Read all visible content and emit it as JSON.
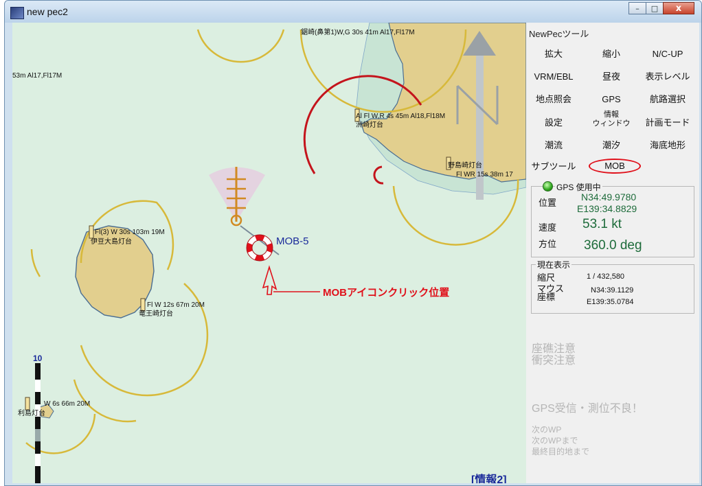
{
  "window": {
    "title": "new pec2",
    "min_label": "–",
    "max_label": "□",
    "close_label": "x"
  },
  "map": {
    "labels": [
      "鋸崎(鼻第1)W,G 30s 41m Al17,Fl17M",
      "53m Al17,Fl17M",
      "Al Fl W,R 4s 45m Al18,Fl18M",
      "洲崎灯台",
      "野島崎灯台",
      "Fl WR 15s 38m 17",
      "Fl(3) W 30s 103m 19M",
      "伊豆大島灯台",
      "Fl W 12s 67m 20M",
      "竜王崎灯台",
      "W 6s 66m 20M",
      "利島灯台"
    ],
    "scale_mark": "10",
    "mob_label": "MOB-5",
    "annotation": "MOBアイコンクリック位置",
    "info_tab": "[情報2]"
  },
  "panel": {
    "title": "NewPecツール",
    "buttons": {
      "zoom_in": "拡大",
      "zoom_out": "縮小",
      "nc_up": "N/C-UP",
      "vrm_ebl": "VRM/EBL",
      "day_night": "昼夜",
      "display_level": "表示レベル",
      "point_lookup": "地点照会",
      "gps": "GPS",
      "route_select": "航路選択",
      "settings": "設定",
      "info_window_1": "情報",
      "info_window_2": "ウィンドウ",
      "plan_mode": "計画モード",
      "current": "潮流",
      "tide": "潮汐",
      "seabed": "海底地形",
      "subtool": "サブツール",
      "mob": "MOB"
    },
    "gps": {
      "legend": "GPS 使用中",
      "position_label": "位置",
      "lat": "N34:49.9780",
      "lon": "E139:34.8829",
      "speed_label": "速度",
      "speed": "53.1  kt",
      "heading_label": "方位",
      "heading": "360.0  deg",
      "status_color": "#2ea61d"
    },
    "current_display": {
      "legend": "現在表示",
      "scale_label": "縮尺",
      "scale": "1 / 432,580",
      "mouse_label_1": "マウス",
      "mouse_label_2": "座標",
      "mouse_lat": "N34:39.1129",
      "mouse_lon": "E139:35.0784"
    },
    "warnings": {
      "grounding": "座礁注意",
      "collision": "衝突注意",
      "gps_error": "GPS受信・測位不良！",
      "next_wp": "次のWP",
      "to_next_wp": "次のWPまで",
      "to_final": "最終目的地まで"
    }
  },
  "colors": {
    "sea": "#dcefe1",
    "land": "#e2cf8e",
    "light_arc": "#d7b93a",
    "mob_red": "#e0101a",
    "label_blue": "#1a2a9a"
  }
}
